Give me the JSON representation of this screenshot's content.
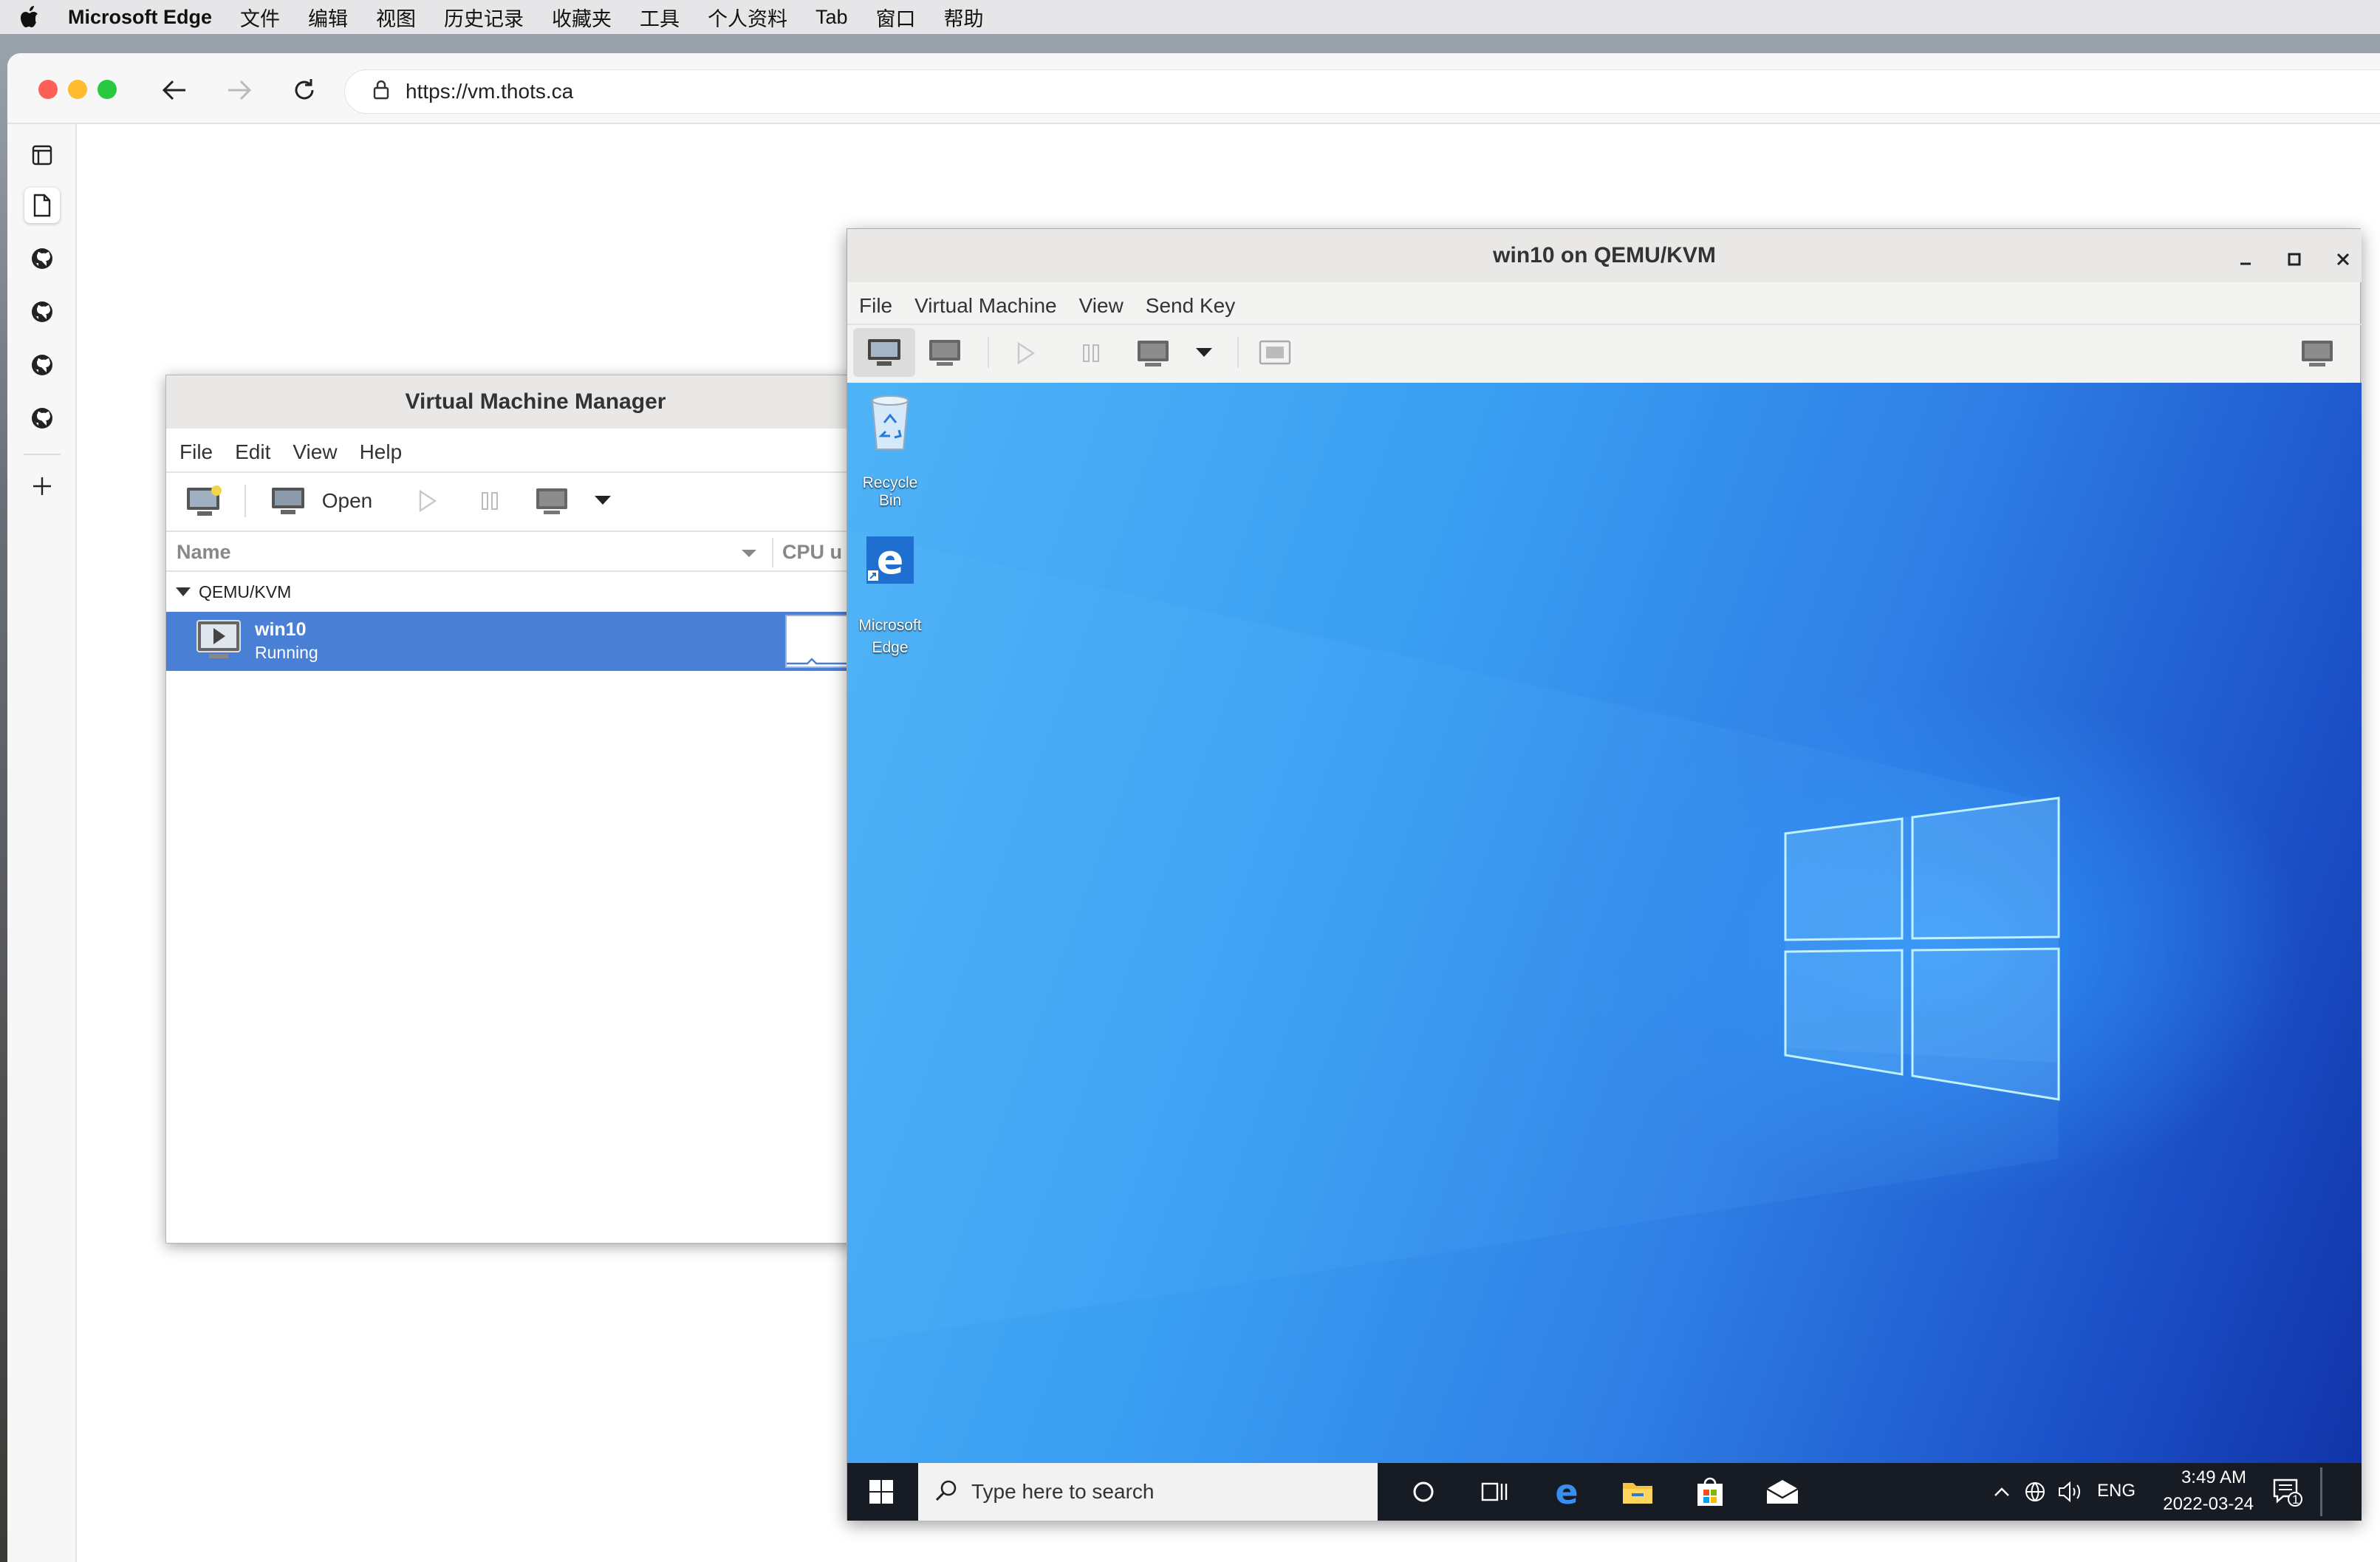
{
  "menubar": {
    "app": "Microsoft Edge",
    "items": [
      "文件",
      "编辑",
      "视图",
      "历史记录",
      "收藏夹",
      "工具",
      "个人资料",
      "Tab",
      "窗口",
      "帮助"
    ]
  },
  "browser": {
    "url": "https://vm.thots.ca"
  },
  "vmm": {
    "title": "Virtual Machine Manager",
    "menu": [
      "File",
      "Edit",
      "View",
      "Help"
    ],
    "open_label": "Open",
    "col_name": "Name",
    "col_cpu": "CPU u",
    "group": "QEMU/KVM",
    "vm_name": "win10",
    "vm_status": "Running"
  },
  "viewer": {
    "title": "win10 on QEMU/KVM",
    "menu": [
      "File",
      "Virtual Machine",
      "View",
      "Send Key"
    ]
  },
  "desktop": {
    "icons": [
      {
        "label": "Recycle Bin"
      },
      {
        "label": "Microsoft Edge"
      }
    ],
    "search_placeholder": "Type here to search",
    "lang": "ENG",
    "time": "3:49 AM",
    "date": "2022-03-24",
    "notif_count": "1"
  },
  "colors": {
    "accent": "#4a7fd6",
    "desktop": "#2f7fe6",
    "taskbar": "#171c24"
  }
}
